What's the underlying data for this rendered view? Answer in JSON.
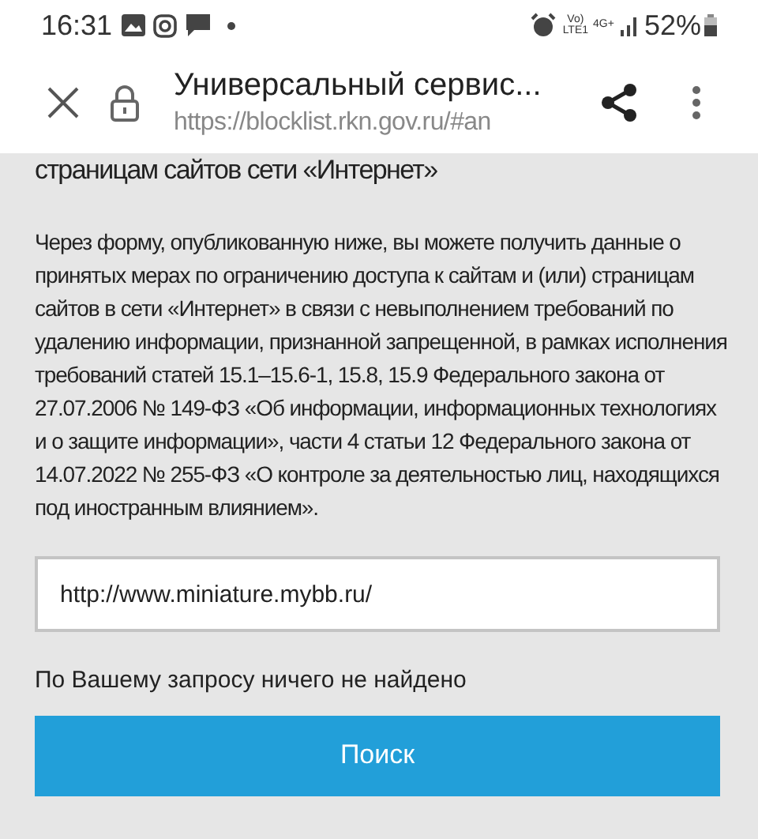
{
  "status_bar": {
    "time": "16:31",
    "volte_top": "Vo)",
    "volte_bottom": "LTE1",
    "network": "4G+",
    "battery": "52%"
  },
  "toolbar": {
    "title": "Универсальный сервис...",
    "url": "https://blocklist.rkn.gov.ru/#an"
  },
  "heading": "страницам сайтов сети «Интернет»",
  "description": "Через форму, опубликованную ниже, вы можете получить данные о принятых мерах по ограничению доступа к сайтам и (или) страницам сайтов в сети «Интернет» в связи с невыполнением требований по удалению информации, признанной запрещенной, в рамках исполнения требований статей 15.1–15.6-1, 15.8, 15.9 Федерального закона от 27.07.2006 № 149-ФЗ «Об информации, информационных технологиях и о защите информации», части 4 статьи 12 Федерального закона от 14.07.2022 № 255-ФЗ «О контроле за деятельностью лиц, находящихся под иностранным влиянием».",
  "search_field": {
    "value": "http://www.miniature.mybb.ru/"
  },
  "result_message": "По Вашему запросу ничего не найдено",
  "search_button": "Поиск"
}
